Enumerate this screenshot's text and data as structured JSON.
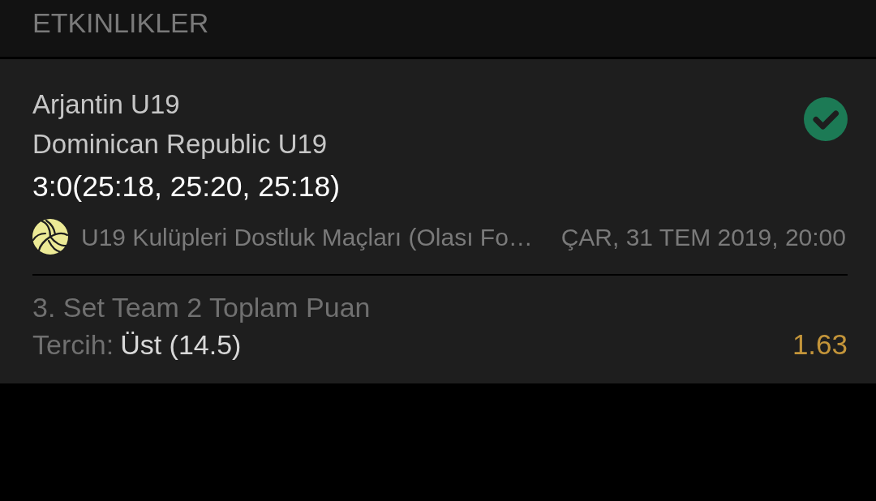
{
  "header": {
    "title": "ETKINLIKLER"
  },
  "events": [
    {
      "teams": [
        "Arjantin U19",
        "Dominican Republic U19"
      ],
      "won": true,
      "score": "3:0(25:18, 25:20, 25:18)",
      "league": "U19 Kulüpleri Dostluk Maçları (Olası Fo…",
      "datetime": "ÇAR, 31 TEM 2019, 20:00",
      "market": "3. Set Team 2 Toplam Puan",
      "selection_label": "Tercih:",
      "selection": "Üst (14.5)",
      "odds": "1.63"
    }
  ]
}
